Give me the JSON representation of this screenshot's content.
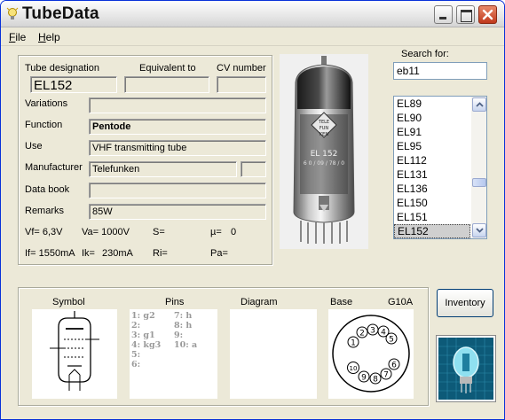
{
  "window": {
    "title": "TubeData"
  },
  "menu": {
    "file": "File",
    "file_mnemonic": "F",
    "help": "Help",
    "help_mnemonic": "H"
  },
  "tube": {
    "designation_label": "Tube designation",
    "equivalent_label": "Equivalent to",
    "cv_label": "CV number",
    "designation": "EL152",
    "equivalent": "",
    "cv": "",
    "variations_label": "Variations",
    "variations": "",
    "function_label": "Function",
    "function": "Pentode",
    "use_label": "Use",
    "use": "VHF transmitting tube",
    "manufacturer_label": "Manufacturer",
    "manufacturer": "Telefunken",
    "manufacturer_extra": "",
    "databook_label": "Data book",
    "databook": "",
    "remarks_label": "Remarks",
    "remarks": "85W",
    "params": {
      "vf": "Vf= 6,3V",
      "va": "Va= 1000V",
      "s": "S=",
      "mu": "µ=",
      "mu_value": "0",
      "if": "If= 1550mA",
      "ik": "Ik=",
      "ik_value": "230mA",
      "ri": "Ri=",
      "pa": "Pa="
    }
  },
  "search": {
    "label": "Search for:",
    "value": "eb11",
    "items": [
      "EL89",
      "EL90",
      "EL91",
      "EL95",
      "EL112",
      "EL131",
      "EL136",
      "EL150",
      "EL151",
      "EL152"
    ],
    "selected": "EL152"
  },
  "bottom": {
    "symbol_label": "Symbol",
    "pins_label": "Pins",
    "diagram_label": "Diagram",
    "base_label": "Base",
    "base_type": "G10A",
    "pins_left": [
      "1: g2",
      "2:",
      "3: g1",
      "4: kg3",
      "5:",
      "6:"
    ],
    "pins_right": [
      "7: h",
      "8: h",
      "9:",
      "10: a"
    ]
  },
  "buttons": {
    "inventory": "Inventory"
  },
  "photo": {
    "glass_text": "EL 152",
    "glass_sub": "6 0 / 09 / 78 / 0"
  },
  "colors": {
    "title_accent": "#e8b000",
    "close": "#c0381c",
    "selection": "#cfcfcf"
  }
}
